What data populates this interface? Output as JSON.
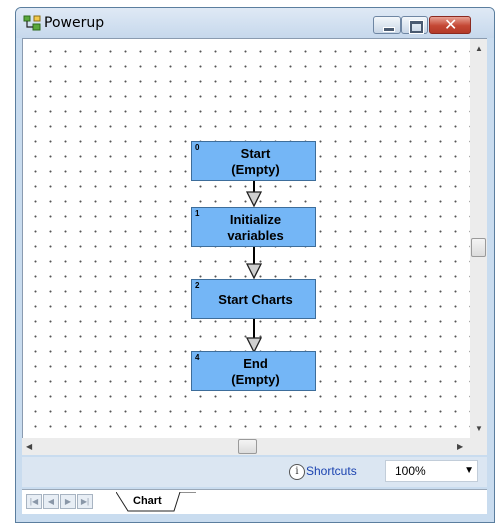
{
  "window": {
    "title": "Powerup"
  },
  "flowchart": {
    "nodes": [
      {
        "number": "0",
        "label": "Start\n(Empty)"
      },
      {
        "number": "1",
        "label": "Initialize\nvariables"
      },
      {
        "number": "2",
        "label": "Start Charts"
      },
      {
        "number": "4",
        "label": "End\n(Empty)"
      }
    ]
  },
  "statusbar": {
    "info_icon": "i",
    "shortcuts_label": "Shortcuts",
    "zoom_value": "100%"
  },
  "tabs": {
    "active_tab": "Chart"
  },
  "colors": {
    "node_fill": "#74b6f6",
    "node_border": "#3d6d9a",
    "close_button": "#c44734",
    "link": "#1b43b0"
  }
}
